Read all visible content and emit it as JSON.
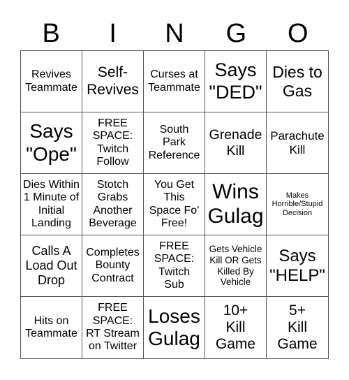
{
  "title_letters": [
    "B",
    "I",
    "N",
    "G",
    "O"
  ],
  "card": {
    "rows": [
      [
        {
          "text": "Revives\nTeammate"
        },
        {
          "text": "Self-\nRevives"
        },
        {
          "text": "Curses at\nTeammate"
        },
        {
          "text": "Says\n\"DED\""
        },
        {
          "text": "Dies to\nGas"
        }
      ],
      [
        {
          "text": "Says\n\"Ope\""
        },
        {
          "text": "FREE\nSPACE:\nTwitch\nFollow"
        },
        {
          "text": "South\nPark\nReference"
        },
        {
          "text": "Grenade\nKill"
        },
        {
          "text": "Parachute\nKill"
        }
      ],
      [
        {
          "text": "Dies Within\n1 Minute of\nInitial\nLanding"
        },
        {
          "text": "Stotch\nGrabs\nAnother\nBeverage"
        },
        {
          "text": "You Get\nThis\nSpace Fo'\nFree!"
        },
        {
          "text": "Wins\nGulag"
        },
        {
          "text": "Makes\nHorrible/Stupid\nDecision"
        }
      ],
      [
        {
          "text": "Calls A\nLoad Out\nDrop"
        },
        {
          "text": "Completes\nBounty\nContract"
        },
        {
          "text": "FREE\nSPACE:\nTwitch\nSub"
        },
        {
          "text": "Gets Vehicle\nKill OR Gets\nKilled By\nVehicle"
        },
        {
          "text": "Says\n\"HELP\""
        }
      ],
      [
        {
          "text": "Hits on\nTeammate"
        },
        {
          "text": "FREE\nSPACE:\nRT Stream\non Twitter"
        },
        {
          "text": "Loses\nGulag"
        },
        {
          "text": "10+\nKill\nGame"
        },
        {
          "text": "5+\nKill\nGame"
        }
      ]
    ]
  }
}
